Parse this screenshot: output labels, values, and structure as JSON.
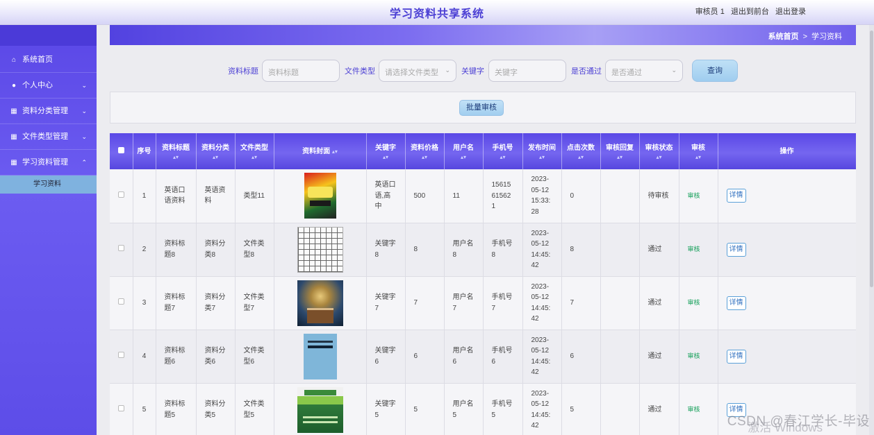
{
  "header": {
    "title": "学习资料共享系统",
    "role": "审核员 1",
    "back_front": "退出到前台",
    "logout": "退出登录"
  },
  "sidebar": {
    "items": [
      {
        "label": "系统首页",
        "icon": "home-icon",
        "chevron": ""
      },
      {
        "label": "个人中心",
        "icon": "user-icon",
        "chevron": "⌄"
      },
      {
        "label": "资料分类管理",
        "icon": "grid-icon",
        "chevron": "⌄"
      },
      {
        "label": "文件类型管理",
        "icon": "grid-icon",
        "chevron": "⌄"
      },
      {
        "label": "学习资料管理",
        "icon": "grid-icon",
        "chevron": "⌃"
      }
    ],
    "subitem": "学习资料"
  },
  "breadcrumb": {
    "home": "系统首页",
    "sep": ">",
    "current": "学习资料"
  },
  "filters": {
    "title_label": "资料标题",
    "title_placeholder": "资料标题",
    "type_label": "文件类型",
    "type_placeholder": "请选择文件类型",
    "keyword_label": "关键字",
    "keyword_placeholder": "关键字",
    "pass_label": "是否通过",
    "pass_placeholder": "是否通过",
    "query_button": "查询"
  },
  "batch_button": "批量审核",
  "table": {
    "headers": [
      "序号",
      "资料标题",
      "资料分类",
      "文件类型",
      "资料封面",
      "关键字",
      "资料价格",
      "用户名",
      "手机号",
      "发布时间",
      "点击次数",
      "审核回复",
      "审核状态",
      "审核",
      "操作"
    ],
    "rows": [
      {
        "no": "1",
        "title": "英语口语资料",
        "category": "英语资料",
        "filetype": "类型11",
        "keyword": "英语口语,高中",
        "price": "500",
        "user": "11",
        "phone": "15615615621",
        "time": "2023-05-12 15:33:28",
        "clicks": "0",
        "reply": "",
        "status": "待审核",
        "audit": "审核",
        "action": "详情"
      },
      {
        "no": "2",
        "title": "资料标题8",
        "category": "资料分类8",
        "filetype": "文件类型8",
        "keyword": "关键字8",
        "price": "8",
        "user": "用户名8",
        "phone": "手机号8",
        "time": "2023-05-12 14:45:42",
        "clicks": "8",
        "reply": "",
        "status": "通过",
        "audit": "审核",
        "action": "详情"
      },
      {
        "no": "3",
        "title": "资料标题7",
        "category": "资料分类7",
        "filetype": "文件类型7",
        "keyword": "关键字7",
        "price": "7",
        "user": "用户名7",
        "phone": "手机号7",
        "time": "2023-05-12 14:45:42",
        "clicks": "7",
        "reply": "",
        "status": "通过",
        "audit": "审核",
        "action": "详情"
      },
      {
        "no": "4",
        "title": "资料标题6",
        "category": "资料分类6",
        "filetype": "文件类型6",
        "keyword": "关键字6",
        "price": "6",
        "user": "用户名6",
        "phone": "手机号6",
        "time": "2023-05-12 14:45:42",
        "clicks": "6",
        "reply": "",
        "status": "通过",
        "audit": "审核",
        "action": "详情"
      },
      {
        "no": "5",
        "title": "资料标题5",
        "category": "资料分类5",
        "filetype": "文件类型5",
        "keyword": "关键字5",
        "price": "5",
        "user": "用户名5",
        "phone": "手机号5",
        "time": "2023-05-12 14:45:42",
        "clicks": "5",
        "reply": "",
        "status": "通过",
        "audit": "审核",
        "action": "详情"
      }
    ]
  },
  "watermark": "CSDN @春江学长-毕设",
  "activate": "激活 Windows",
  "colors": {
    "brand": "#4b3fd4",
    "header_grad_start": "#5a48e6",
    "audit_green": "#16a05a",
    "submenu_bg": "#7fb2df"
  }
}
